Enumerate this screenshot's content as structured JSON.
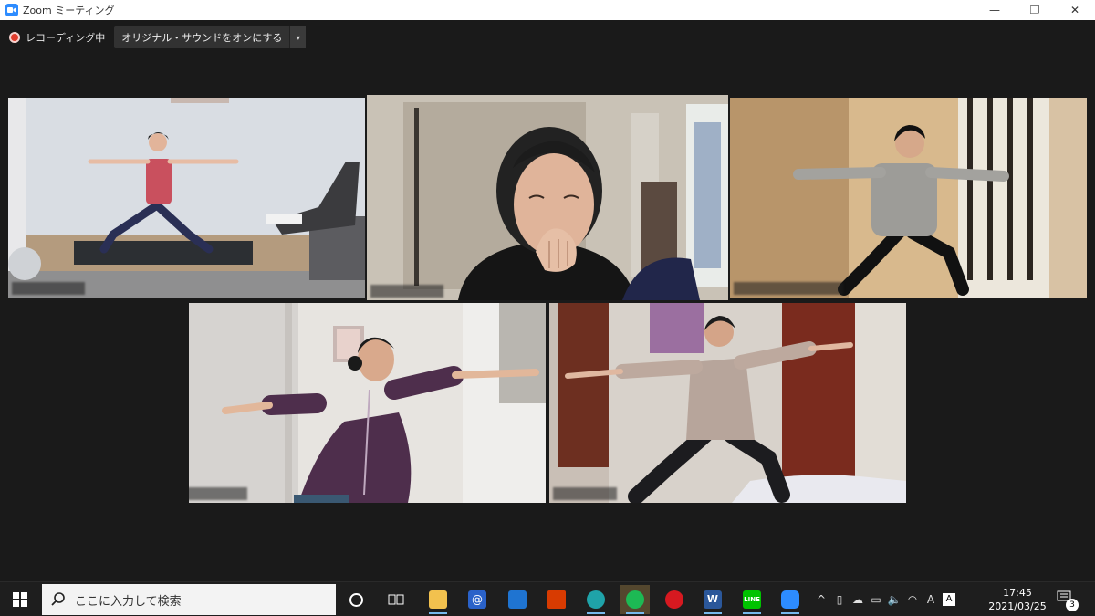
{
  "window": {
    "title": "Zoom ミーティング",
    "controls": {
      "minimize": "—",
      "restore": "❐",
      "close": "✕"
    }
  },
  "recording": {
    "status_label": "レコーディング中",
    "original_sound_button": "オリジナル・サウンドをオンにする",
    "dropdown_glyph": "▾"
  },
  "participants": [
    {
      "name": "",
      "active": false,
      "camera": "woman in red tank top, warrior pose on yoga mat"
    },
    {
      "name": "",
      "active": true,
      "camera": "smiling woman covering mouth, close-up"
    },
    {
      "name": "",
      "active": false,
      "camera": "man in grey sweater, warrior pose"
    },
    {
      "name": "",
      "active": false,
      "camera": "woman in purple hoodie, warrior pose"
    },
    {
      "name": "",
      "active": false,
      "camera": "woman in beige hoodie, warrior pose"
    }
  ],
  "taskbar": {
    "search_placeholder": "ここに入力して検索",
    "apps": [
      "cortana-icon",
      "task-view-icon",
      "file-explorer-icon",
      "imenu-icon",
      "mail-icon",
      "office-icon",
      "edge-icon",
      "spotify-icon",
      "trend-micro-icon",
      "word-icon",
      "line-icon",
      "zoom-icon"
    ],
    "tray": {
      "chevron": "^",
      "ime": "A"
    },
    "clock": {
      "time": "17:45",
      "date": "2021/03/25"
    },
    "notification_count": "3"
  },
  "colors": {
    "active_speaker_border": "#bfe54a",
    "rec_red": "#e13c2c",
    "zoom_blue": "#2d8cff"
  }
}
